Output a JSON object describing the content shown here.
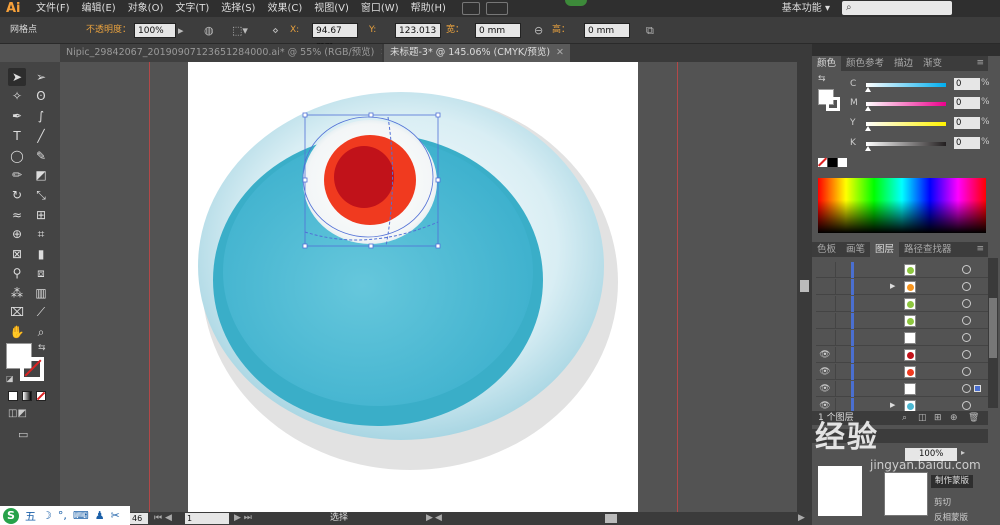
{
  "app": {
    "logo": "Ai",
    "workspace": "基本功能"
  },
  "menu": [
    "文件(F)",
    "编辑(E)",
    "对象(O)",
    "文字(T)",
    "选择(S)",
    "效果(C)",
    "视图(V)",
    "窗口(W)",
    "帮助(H)"
  ],
  "control_bar": {
    "selection_label": "网格点",
    "opacity_label": "不透明度：",
    "opacity_value": "100%",
    "x_label": "X:",
    "x_value": "94.67 mm",
    "y_label": "Y:",
    "y_value": "123.013",
    "w_label": "宽：",
    "w_value": "0 mm",
    "h_label": "高：",
    "h_value": "0 mm"
  },
  "tabs": [
    {
      "label": "Nipic_29842067_20190907123651284000.ai* @ 55% (RGB/预览)",
      "active": false
    },
    {
      "label": "未标题-3* @ 145.06% (CMYK/预览)",
      "active": true
    }
  ],
  "color_panel": {
    "tabs": [
      "颜色",
      "颜色参考",
      "描边",
      "渐变"
    ],
    "channels": [
      {
        "label": "C",
        "value": "0",
        "unit": "%",
        "color": "#00aeef"
      },
      {
        "label": "M",
        "value": "0",
        "unit": "%",
        "color": "#ec008c"
      },
      {
        "label": "Y",
        "value": "0",
        "unit": "%",
        "color": "#fff200"
      },
      {
        "label": "K",
        "value": "0",
        "unit": "%",
        "color": "#231f20"
      }
    ]
  },
  "layers_panel": {
    "tabs": [
      "色板",
      "画笔",
      "图层",
      "路径查找器"
    ],
    "footer": "1 个图层",
    "rows": [
      {
        "visible": false,
        "expand": false,
        "thumb_color": "#8dc63f",
        "target_selected": false
      },
      {
        "visible": false,
        "expand": true,
        "thumb_color": "#f7941d",
        "target_selected": false
      },
      {
        "visible": false,
        "expand": false,
        "thumb_color": "#8dc63f",
        "target_selected": false
      },
      {
        "visible": false,
        "expand": false,
        "thumb_color": "#8dc63f",
        "target_selected": false
      },
      {
        "visible": false,
        "expand": false,
        "thumb_color": "#ffffff",
        "target_selected": false
      },
      {
        "visible": true,
        "expand": false,
        "thumb_color": "#c1121a",
        "target_selected": false
      },
      {
        "visible": true,
        "expand": false,
        "thumb_color": "#f03a1f",
        "target_selected": false
      },
      {
        "visible": true,
        "expand": false,
        "thumb_color": "#ffffff",
        "target_selected": true
      },
      {
        "visible": true,
        "expand": true,
        "thumb_color": "#4cb8d2",
        "target_selected": false
      }
    ]
  },
  "transparency_panel": {
    "opacity_value": "100%",
    "make_mask": "制作蒙版",
    "clip": "剪切",
    "invert_mask": "反相蒙版"
  },
  "watermark": {
    "text": "经验",
    "sub": "jingyan.baidu.com"
  },
  "status": {
    "zoom": "46",
    "page": "1",
    "tool": "选择"
  },
  "ime": {
    "logo": "S",
    "items": [
      "五",
      "☽",
      "°,",
      "⌨",
      "♟",
      "✂"
    ]
  }
}
